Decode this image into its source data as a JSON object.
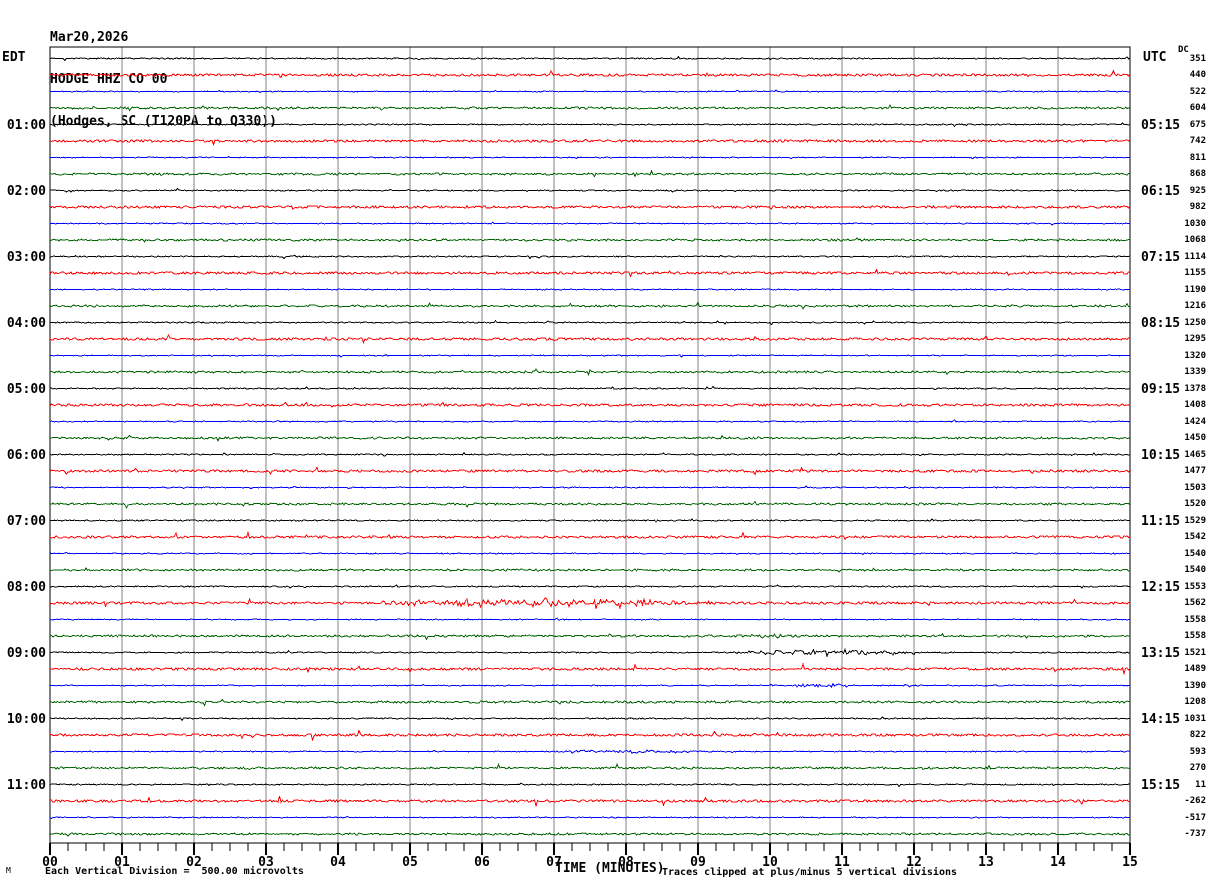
{
  "header": {
    "date": "Mar20,2026",
    "station": "HODGE HHZ CO 00",
    "location": "(Hodges, SC (T120PA to Q330))"
  },
  "plot": {
    "left_timezone": "EDT",
    "right_timezone": "UTC",
    "dc_label": "DC",
    "left_time_labels": [
      "01:00",
      "02:00",
      "03:00",
      "04:00",
      "05:00",
      "06:00",
      "07:00",
      "08:00",
      "09:00",
      "10:00",
      "11:00"
    ],
    "right_time_labels": [
      "05:15",
      "06:15",
      "07:15",
      "08:15",
      "09:15",
      "10:15",
      "11:15",
      "12:15",
      "13:15",
      "14:15",
      "15:15"
    ],
    "dc_values": [
      351,
      440,
      522,
      604,
      675,
      742,
      811,
      868,
      925,
      982,
      1030,
      1068,
      1114,
      1155,
      1190,
      1216,
      1250,
      1295,
      1320,
      1339,
      1378,
      1408,
      1424,
      1450,
      1465,
      1477,
      1503,
      1520,
      1529,
      1542,
      1540,
      1540,
      1553,
      1562,
      1558,
      1558,
      1521,
      1489,
      1390,
      1208,
      1031,
      822,
      593,
      270,
      11,
      -262,
      -517,
      -737
    ],
    "x_tick_labels": [
      "00",
      "01",
      "02",
      "03",
      "04",
      "05",
      "06",
      "07",
      "08",
      "09",
      "10",
      "11",
      "12",
      "13",
      "14",
      "15"
    ]
  },
  "footer": {
    "scale_note": "Each Vertical Division =  500.00 microvolts",
    "axis_title": "TIME (MINUTES)",
    "clip_note": "Traces clipped at plus/minus 5 vertical divisions",
    "watermark": "M"
  },
  "chart_data": {
    "type": "line",
    "subtype": "helicorder-seismogram",
    "title": "HODGE HHZ CO 00 — Mar20,2026 (Hodges, SC (T120PA to Q330))",
    "xlabel": "TIME (MINUTES)",
    "x_range_minutes": [
      0,
      15
    ],
    "minutes_per_line": 15,
    "lines": 48,
    "line_start_labels_local_every_4th": [
      "01:00",
      "02:00",
      "03:00",
      "04:00",
      "05:00",
      "06:00",
      "07:00",
      "08:00",
      "09:00",
      "10:00",
      "11:00"
    ],
    "line_end_labels_utc_every_4th": [
      "05:15",
      "06:15",
      "07:15",
      "08:15",
      "09:15",
      "10:15",
      "11:15",
      "12:15",
      "13:15",
      "14:15",
      "15:15"
    ],
    "dc_offset_per_line": [
      351,
      440,
      522,
      604,
      675,
      742,
      811,
      868,
      925,
      982,
      1030,
      1068,
      1114,
      1155,
      1190,
      1216,
      1250,
      1295,
      1320,
      1339,
      1378,
      1408,
      1424,
      1450,
      1465,
      1477,
      1503,
      1520,
      1529,
      1542,
      1540,
      1540,
      1553,
      1562,
      1558,
      1558,
      1521,
      1489,
      1390,
      1208,
      1031,
      822,
      593,
      270,
      11,
      -262,
      -517,
      -737
    ],
    "microvolts_per_division": 500.0,
    "clip_divisions": 5,
    "trace_color_cycle": [
      "#000000",
      "#ff0000",
      "#0000ff",
      "#006400"
    ],
    "grid_color": "#808080",
    "background_color": "#ffffff",
    "grid": "vertical lines every 1 minute",
    "noise_amplitude_by_color": {
      "black": 0.55,
      "red": 1.25,
      "blue": 0.4,
      "green": 0.95
    },
    "events": [
      {
        "line_index": 33,
        "local_start": "08:15",
        "start_min": 4.0,
        "end_min": 9.5,
        "relative_amplitude": 4.5
      },
      {
        "line_index": 35,
        "local_start": "08:45",
        "start_min": 8.7,
        "end_min": 10.6,
        "relative_amplitude": 2.5
      },
      {
        "line_index": 36,
        "local_start": "09:00",
        "start_min": 9.4,
        "end_min": 12.2,
        "relative_amplitude": 3.5
      },
      {
        "line_index": 38,
        "local_start": "09:30",
        "start_min": 10.3,
        "end_min": 11.3,
        "relative_amplitude": 2.2
      },
      {
        "line_index": 42,
        "local_start": "10:30",
        "start_min": 6.8,
        "end_min": 9.3,
        "relative_amplitude": 2.2
      }
    ]
  }
}
